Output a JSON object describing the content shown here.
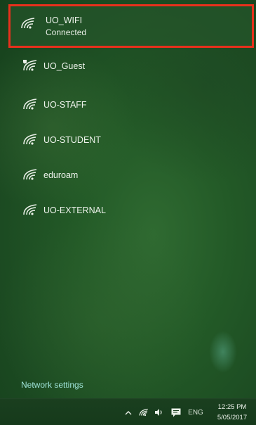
{
  "networks": [
    {
      "name": "UO_WIFI",
      "status": "Connected",
      "icon": "wifi-icon",
      "secured": true
    },
    {
      "name": "UO_Guest",
      "status": "",
      "icon": "wifi-open-icon",
      "secured": false
    },
    {
      "name": "UO-STAFF",
      "status": "",
      "icon": "wifi-icon",
      "secured": true
    },
    {
      "name": "UO-STUDENT",
      "status": "",
      "icon": "wifi-icon",
      "secured": true
    },
    {
      "name": "eduroam",
      "status": "",
      "icon": "wifi-icon",
      "secured": true
    },
    {
      "name": "UO-EXTERNAL",
      "status": "",
      "icon": "wifi-icon",
      "secured": true
    }
  ],
  "flyout": {
    "settings_link": "Network settings",
    "highlight_color": "#e8301c",
    "link_color": "#9fe3d8"
  },
  "taskbar": {
    "tray_icons": [
      "chevron-up-icon",
      "wifi-icon",
      "volume-icon",
      "action-center-icon"
    ],
    "language": "ENG",
    "time": "12:25 PM",
    "date": "5/05/2017"
  }
}
